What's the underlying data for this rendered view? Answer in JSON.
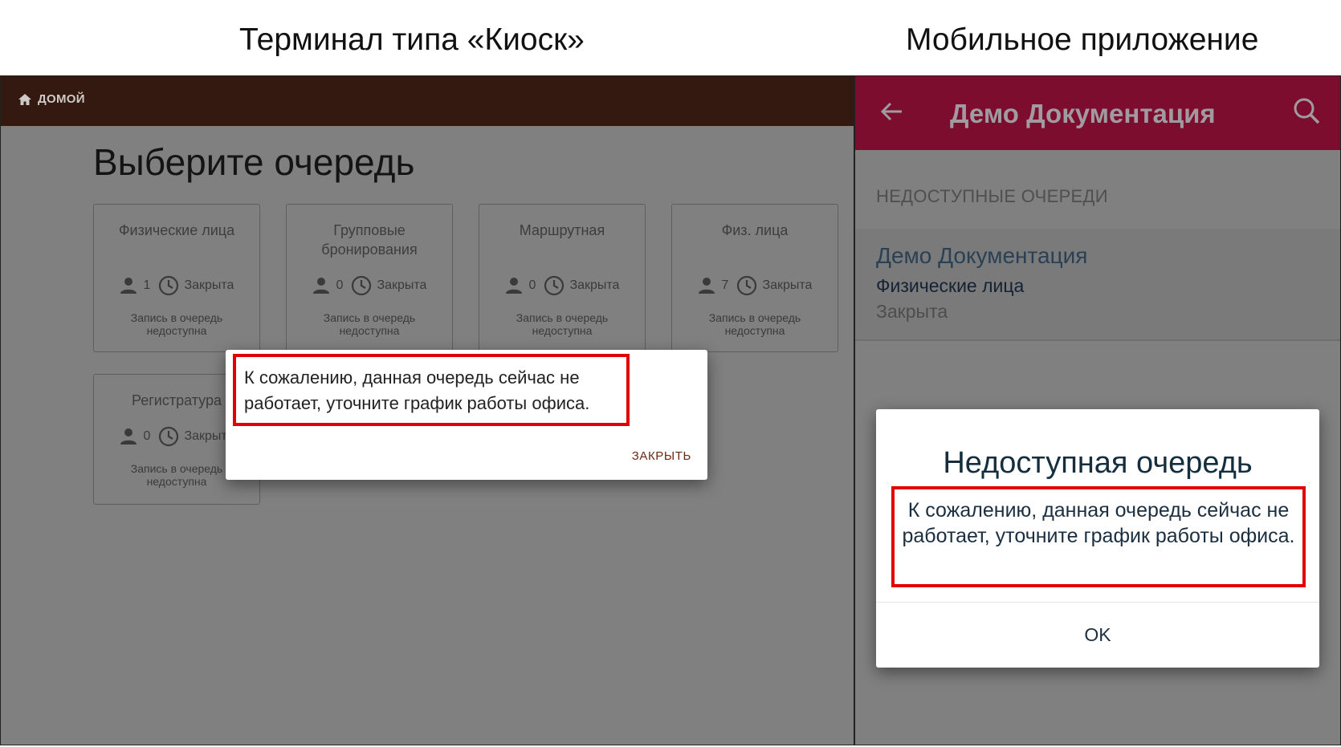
{
  "captions": {
    "kiosk": "Терминал типа «Киоск»",
    "mobile": "Мобильное приложение"
  },
  "kiosk": {
    "home_label": "ДОМОЙ",
    "page_title": "Выберите очередь",
    "cards": [
      {
        "title": "Физические лица",
        "count": "1",
        "status": "Закрыта",
        "note_line1": "Запись в очередь",
        "note_line2": "недоступна"
      },
      {
        "title": "Групповые бронирования",
        "count": "0",
        "status": "Закрыта",
        "note_line1": "Запись в очередь",
        "note_line2": "недоступна"
      },
      {
        "title": "Маршрутная",
        "count": "0",
        "status": "Закрыта",
        "note_line1": "Запись в очередь",
        "note_line2": "недоступна"
      },
      {
        "title": "Физ. лица",
        "count": "7",
        "status": "Закрыта",
        "note_line1": "Запись в очередь",
        "note_line2": "недоступна"
      },
      {
        "title": "Регистратура",
        "count": "0",
        "status": "Закрыта",
        "note_line1": "Запись в очередь",
        "note_line2": "недоступна"
      }
    ],
    "dialog": {
      "message": "К сожалению, данная очередь сейчас не работает, уточните график работы офиса.",
      "close_label": "ЗАКРЫТЬ"
    }
  },
  "mobile": {
    "title": "Демо Документация",
    "section_header": "НЕДОСТУПНЫЕ ОЧЕРЕДИ",
    "item": {
      "name": "Демо Документация",
      "queue": "Физические лица",
      "status": "Закрыта"
    },
    "dialog": {
      "title": "Недоступная очередь",
      "message": "К сожалению, данная очередь сейчас не работает, уточните график работы офиса.",
      "ok_label": "OK"
    }
  },
  "colors": {
    "kiosk_header": "#331910",
    "mobile_header": "#7c0d2e",
    "overlay": "#808080",
    "highlight": "#e30000"
  },
  "icons": {
    "home": "home-icon",
    "person": "person-icon",
    "clock": "clock-icon",
    "back": "arrow-back-icon",
    "search": "search-icon"
  }
}
